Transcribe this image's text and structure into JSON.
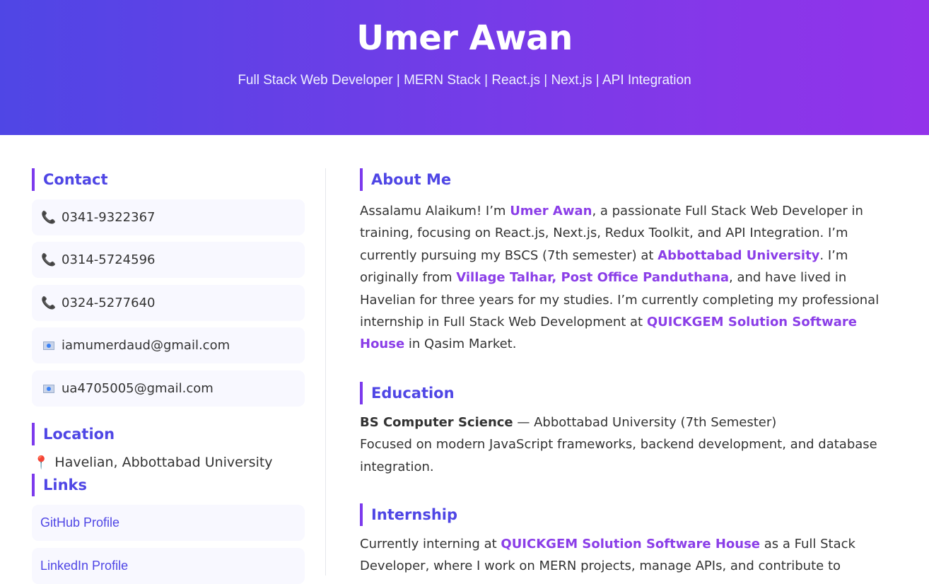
{
  "header": {
    "name": "Umer Awan",
    "subtitle": "Full Stack Web Developer | MERN Stack | React.js | Next.js | API Integration"
  },
  "sidebar": {
    "contact_title": "Contact",
    "contacts": [
      {
        "icon": "phone-icon",
        "text": "0341-9322367"
      },
      {
        "icon": "phone-icon",
        "text": "0314-5724596"
      },
      {
        "icon": "phone-icon",
        "text": "0324-5277640"
      },
      {
        "icon": "email-icon",
        "text": "iamumerdaud@gmail.com"
      },
      {
        "icon": "email-icon",
        "text": "ua4705005@gmail.com"
      }
    ],
    "location_title": "Location",
    "location": "Havelian, Abbottabad University",
    "links_title": "Links",
    "links": [
      {
        "text": "GitHub Profile"
      },
      {
        "text": "LinkedIn Profile"
      }
    ]
  },
  "about": {
    "title": "About Me",
    "t1": "Assalamu Alaikum! I’m ",
    "name": "Umer Awan",
    "t2": ", a passionate Full Stack Web Developer in training, focusing on React.js, Next.js, Redux Toolkit, and API Integration. I’m currently pursuing my BSCS (7th semester) at ",
    "university": "Abbottabad University",
    "t3": ". I’m originally from ",
    "village": "Village Talhar, Post Office Panduthana",
    "t4": ", and have lived in Havelian for three years for my studies. I’m currently completing my professional internship in Full Stack Web Development at ",
    "company": "QUICKGEM Solution Software House",
    "t5": " in Qasim Market."
  },
  "education": {
    "title": "Education",
    "degree": "BS Computer Science",
    "detail": " — Abbottabad University (7th Semester)",
    "focus": "Focused on modern JavaScript frameworks, backend development, and database integration."
  },
  "internship": {
    "title": "Internship",
    "t1": "Currently interning at ",
    "company": "QUICKGEM Solution Software House",
    "t2": " as a Full Stack Developer, where I work on MERN projects, manage APIs, and contribute to"
  },
  "colors": {
    "header_gradient_start": "#4f46e5",
    "header_gradient_end": "#9333ea",
    "accent": "#4f46e5",
    "highlight": "#8b3ee8",
    "phone_icon": "#e0245e"
  }
}
